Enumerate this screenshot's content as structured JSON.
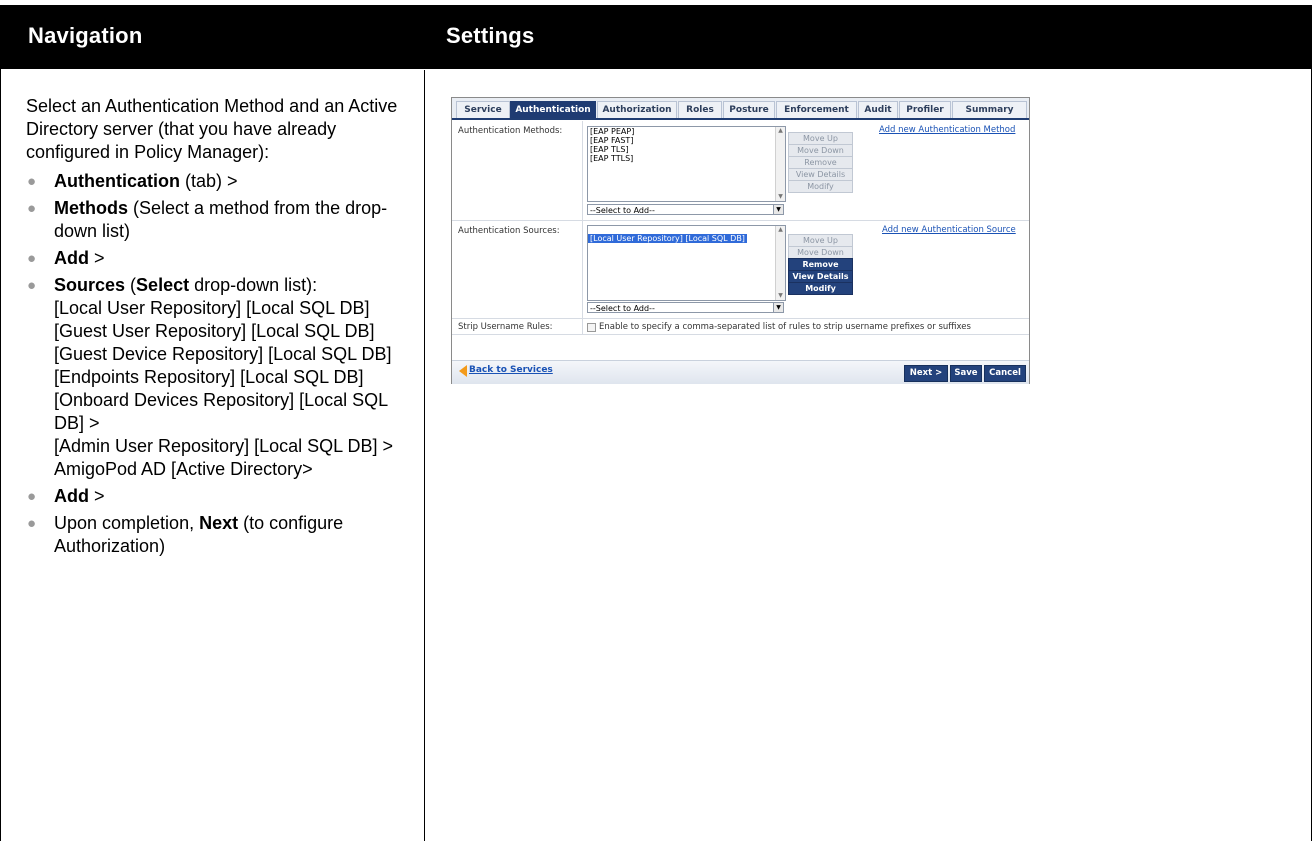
{
  "header": {
    "navigation": "Navigation",
    "settings": "Settings"
  },
  "nav": {
    "intro": "Select an Authentication Method and an Active Directory server (that you have already configured in Policy Manager):",
    "items": [
      {
        "bold": "Authentication",
        "rest": " (tab) >"
      },
      {
        "bold": "Methods",
        "rest": " (Select a method from the drop-down list)"
      },
      {
        "bold": "Add",
        "rest": " >"
      },
      {
        "bold": "Sources",
        "pre": " (",
        "bold2": "Select",
        "rest": " drop-down list):",
        "sublines": [
          "[Local User Repository] [Local SQL DB]",
          "[Guest User Repository] [Local SQL DB]",
          "[Guest Device Repository] [Local SQL DB]",
          "[Endpoints Repository] [Local SQL DB]",
          "[Onboard Devices Repository] [Local SQL DB] >",
          "[Admin User Repository] [Local SQL DB] >",
          "AmigoPod AD [Active Directory>"
        ]
      },
      {
        "bold": "Add",
        "rest": " >"
      },
      {
        "pre": "Upon completion, ",
        "bold": "Next",
        "rest": " (to configure Authorization)"
      }
    ]
  },
  "screenshot": {
    "tabs": [
      "Service",
      "Authentication",
      "Authorization",
      "Roles",
      "Posture",
      "Enforcement",
      "Audit",
      "Profiler",
      "Summary"
    ],
    "active_tab": "Authentication",
    "methods": {
      "label": "Authentication Methods:",
      "items": [
        "[EAP PEAP]",
        "[EAP FAST]",
        "[EAP TLS]",
        "[EAP TTLS]"
      ],
      "select": "--Select to Add--",
      "buttons": [
        "Move Up",
        "Move Down",
        "Remove",
        "View Details",
        "Modify"
      ],
      "link": "Add new Authentication Method"
    },
    "sources": {
      "label": "Authentication Sources:",
      "items": [
        "[Local User Repository] [Local SQL DB]"
      ],
      "select": "--Select to Add--",
      "buttons": [
        "Move Up",
        "Move Down",
        "Remove",
        "View Details",
        "Modify"
      ],
      "link": "Add new Authentication Source"
    },
    "strip": {
      "label": "Strip Username Rules:",
      "text": "Enable to specify a comma-separated list of rules to strip username prefixes or suffixes"
    },
    "footer": {
      "back": "Back to Services",
      "next": "Next >",
      "save": "Save",
      "cancel": "Cancel"
    }
  }
}
